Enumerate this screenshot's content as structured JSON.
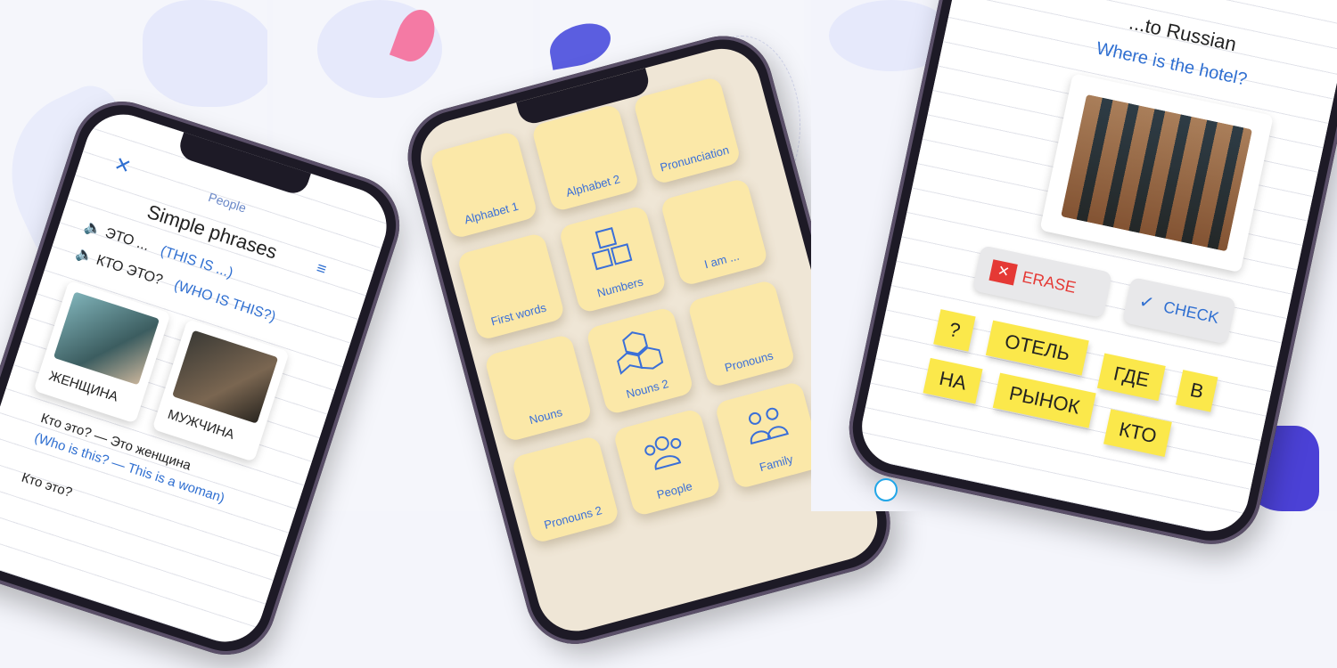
{
  "colors": {
    "accent": "#2f6fd1",
    "highlight": "#e53935",
    "tile": "#fbe8a8",
    "sticky": "#fbe84b"
  },
  "panel1": {
    "close_icon": "close-icon",
    "category": "People",
    "title": "Simple phrases",
    "menu_icon": "menu-icon",
    "phrases": [
      {
        "ru": "ЭТО ...",
        "en": "(THIS IS ...)"
      },
      {
        "ru": "КТО ЭТО?",
        "en": "(WHO IS THIS?)"
      }
    ],
    "cards": [
      {
        "label": "ЖЕНЩИНА"
      },
      {
        "label": "МУЖЧИНА"
      }
    ],
    "example_ru": "Кто это? — Это женщина",
    "example_en": "(Who is this? — This is a woman)",
    "footer_ru": "Кто это?"
  },
  "panel2": {
    "tiles": [
      {
        "label": "Alphabet 1",
        "icon": "alphabet-icon"
      },
      {
        "label": "Alphabet 2",
        "icon": "alphabet-icon"
      },
      {
        "label": "Pronunciation",
        "icon": "pronunciation-icon"
      },
      {
        "label": "First words",
        "icon": "chat-people-icon"
      },
      {
        "label": "Numbers",
        "icon": "number-blocks-icon"
      },
      {
        "label": "I am ...",
        "icon": "person-icon"
      },
      {
        "label": "Nouns",
        "icon": "cubes-icon"
      },
      {
        "label": "Nouns 2",
        "icon": "cubes-icon"
      },
      {
        "label": "Pronouns",
        "icon": "group-icon"
      },
      {
        "label": "Pronouns 2",
        "icon": "pair-icon"
      },
      {
        "label": "People",
        "icon": "crowd-icon"
      },
      {
        "label": "Family",
        "icon": "family-icon"
      }
    ]
  },
  "panel3": {
    "heading": "...to Russian",
    "question": "Where is the hotel?",
    "erase_label": "ERASE",
    "check_label": "CHECK",
    "words": [
      "?",
      "ОТЕЛЬ",
      "ГДЕ",
      "НА",
      "РЫНОК",
      "В",
      "КТО"
    ]
  }
}
